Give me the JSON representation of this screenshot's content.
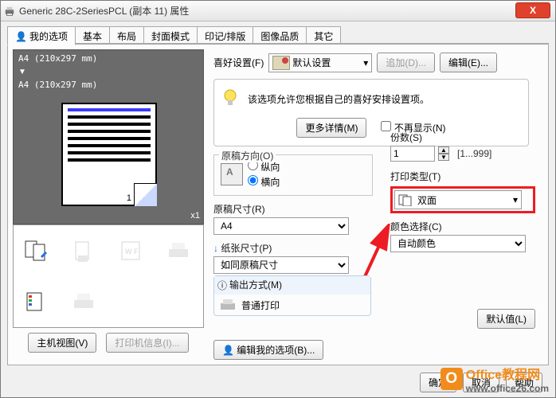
{
  "window": {
    "title": "Generic 28C-2SeriesPCL (副本 11) 属性"
  },
  "tabs": [
    "我的选项",
    "基本",
    "布局",
    "封面模式",
    "印记/排版",
    "图像品质",
    "其它"
  ],
  "preview": {
    "paper_from": "A4 (210x297 mm)",
    "paper_to": "A4 (210x297 mm)",
    "count_label": "x1",
    "page_num": "1"
  },
  "left_buttons": {
    "host_view": "主机视图(V)",
    "printer_info": "打印机信息(I)..."
  },
  "favorite": {
    "label": "喜好设置(F)",
    "value": "默认设置",
    "add": "追加(D)...",
    "edit": "编辑(E)..."
  },
  "hint": {
    "text": "该选项允许您根据自己的喜好安排设置项。",
    "more": "更多详情(M)",
    "hide_label": "不再显示(N)"
  },
  "orientation": {
    "group": "原稿方向(O)",
    "portrait": "纵向",
    "landscape": "横向"
  },
  "original_size": {
    "label": "原稿尺寸(R)",
    "value": "A4"
  },
  "paper_size": {
    "label": "纸张尺寸(P)",
    "value": "如同原稿尺寸"
  },
  "output": {
    "label": "输出方式(M)",
    "value": "普通打印"
  },
  "copies": {
    "label": "份数(S)",
    "value": "1",
    "range": "[1...999]"
  },
  "print_kind": {
    "label": "打印类型(T)",
    "value": "双面"
  },
  "color": {
    "label": "颜色选择(C)",
    "value": "自动颜色"
  },
  "buttons": {
    "edit_my": "编辑我的选项(B)...",
    "defaults": "默认值(L)",
    "ok": "确定",
    "cancel": "取消",
    "help": "帮助"
  },
  "watermark": {
    "brand": "Office教程网",
    "url": "www.office26.com"
  }
}
